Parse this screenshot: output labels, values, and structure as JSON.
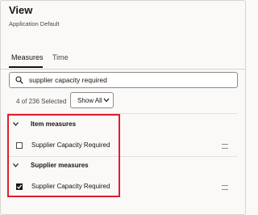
{
  "header": {
    "title": "View",
    "subtitle": "Application Default"
  },
  "tabs": [
    {
      "label": "Measures",
      "active": true
    },
    {
      "label": "Time",
      "active": false
    }
  ],
  "search": {
    "value": "supplier capacity required",
    "placeholder": ""
  },
  "selection": {
    "count_text": "4 of 236 Selected",
    "show_filter": "Show All"
  },
  "groups": [
    {
      "label": "Item measures",
      "items": [
        {
          "label": "Supplier Capacity Required",
          "checked": false
        }
      ]
    },
    {
      "label": "Supplier measures",
      "items": [
        {
          "label": "Supplier Capacity Required",
          "checked": true
        }
      ]
    }
  ],
  "colors": {
    "highlight_border": "#e01e2b",
    "text": "#161513",
    "border": "#8f8a86"
  }
}
